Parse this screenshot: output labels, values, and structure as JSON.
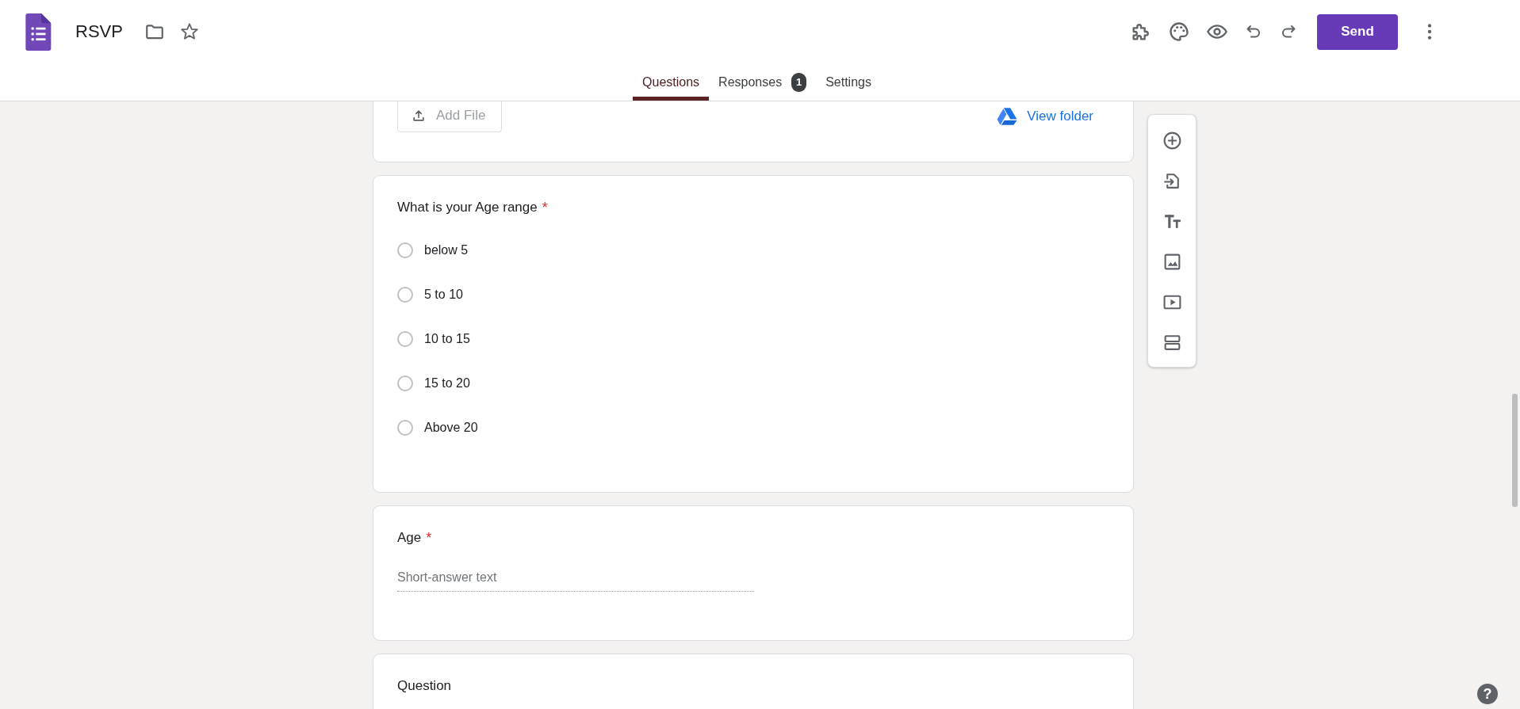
{
  "app": {
    "title": "RSVP"
  },
  "toolbar": {
    "send_button": "Send"
  },
  "tabs": [
    {
      "label": "Questions",
      "selected": true
    },
    {
      "label": "Responses",
      "selected": false,
      "badge": "1"
    },
    {
      "label": "Settings",
      "selected": false
    }
  ],
  "cards": [
    {
      "kind": "upload",
      "add_file_button": "Add File",
      "view_folder_link": "View folder"
    },
    {
      "kind": "choice",
      "question": "What is your Age range",
      "required_mark": "*",
      "options": [
        {
          "label": "below 5",
          "selected": false
        },
        {
          "label": "5 to 10",
          "selected": false
        },
        {
          "label": "10 to 15",
          "selected": false
        },
        {
          "label": "15 to 20",
          "selected": false
        },
        {
          "label": "Above 20",
          "selected": false
        }
      ]
    },
    {
      "kind": "short",
      "question": "Age",
      "required_mark": "*",
      "placeholder": "Short-answer text"
    },
    {
      "kind": "title",
      "question": "Question"
    }
  ],
  "help_button": "?"
}
